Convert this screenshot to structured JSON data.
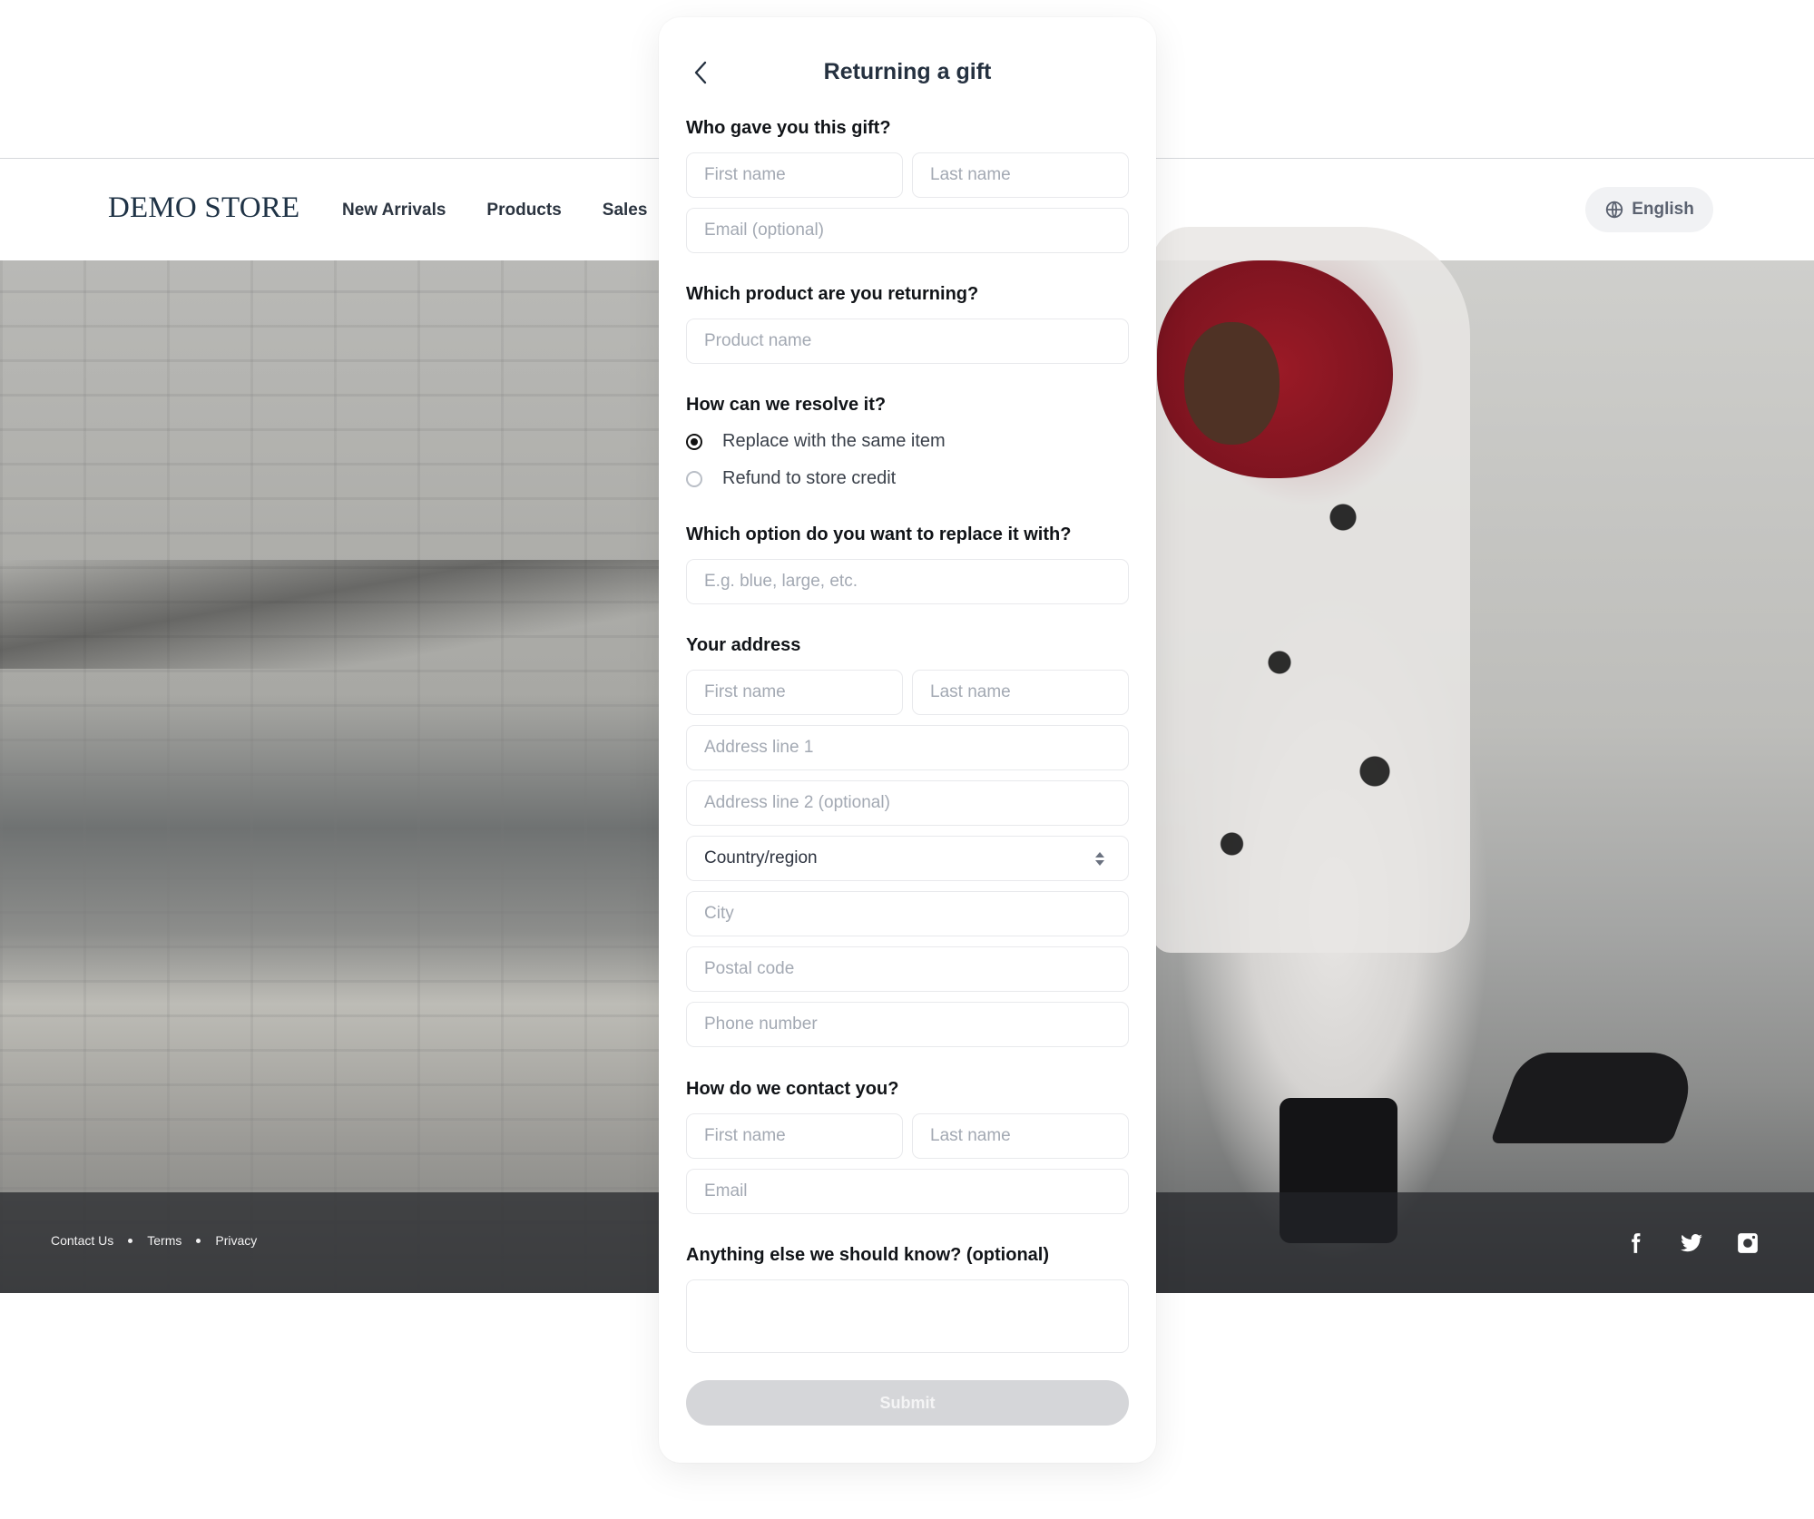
{
  "store": {
    "logo": "DEMO STORE",
    "nav": [
      "New Arrivals",
      "Products",
      "Sales"
    ],
    "language": "English",
    "footer_links": [
      "Contact Us",
      "Terms",
      "Privacy"
    ],
    "social": [
      "facebook-icon",
      "twitter-icon",
      "instagram-icon"
    ]
  },
  "form": {
    "title": "Returning a gift",
    "giver": {
      "question": "Who gave you this gift?",
      "first_name_placeholder": "First name",
      "last_name_placeholder": "Last name",
      "email_placeholder": "Email (optional)"
    },
    "product": {
      "question": "Which product are you returning?",
      "placeholder": "Product name"
    },
    "resolution": {
      "question": "How can we resolve it?",
      "options": [
        {
          "label": "Replace with the same item",
          "selected": true
        },
        {
          "label": "Refund to store credit",
          "selected": false
        }
      ]
    },
    "replacement": {
      "question": "Which option do you want to replace it with?",
      "placeholder": "E.g. blue, large, etc."
    },
    "address": {
      "question": "Your address",
      "first_name_placeholder": "First name",
      "last_name_placeholder": "Last name",
      "line1_placeholder": "Address line 1",
      "line2_placeholder": "Address line 2 (optional)",
      "country_value": "Country/region",
      "city_placeholder": "City",
      "postal_placeholder": "Postal code",
      "phone_placeholder": "Phone number"
    },
    "contact": {
      "question": "How do we contact you?",
      "first_name_placeholder": "First name",
      "last_name_placeholder": "Last name",
      "email_placeholder": "Email"
    },
    "notes": {
      "question": "Anything else we should know? (optional)"
    },
    "submit_label": "Submit"
  },
  "colors": {
    "submit_disabled": "#d5d6d9",
    "title": "#253140",
    "placeholder": "#a3a9b3"
  }
}
